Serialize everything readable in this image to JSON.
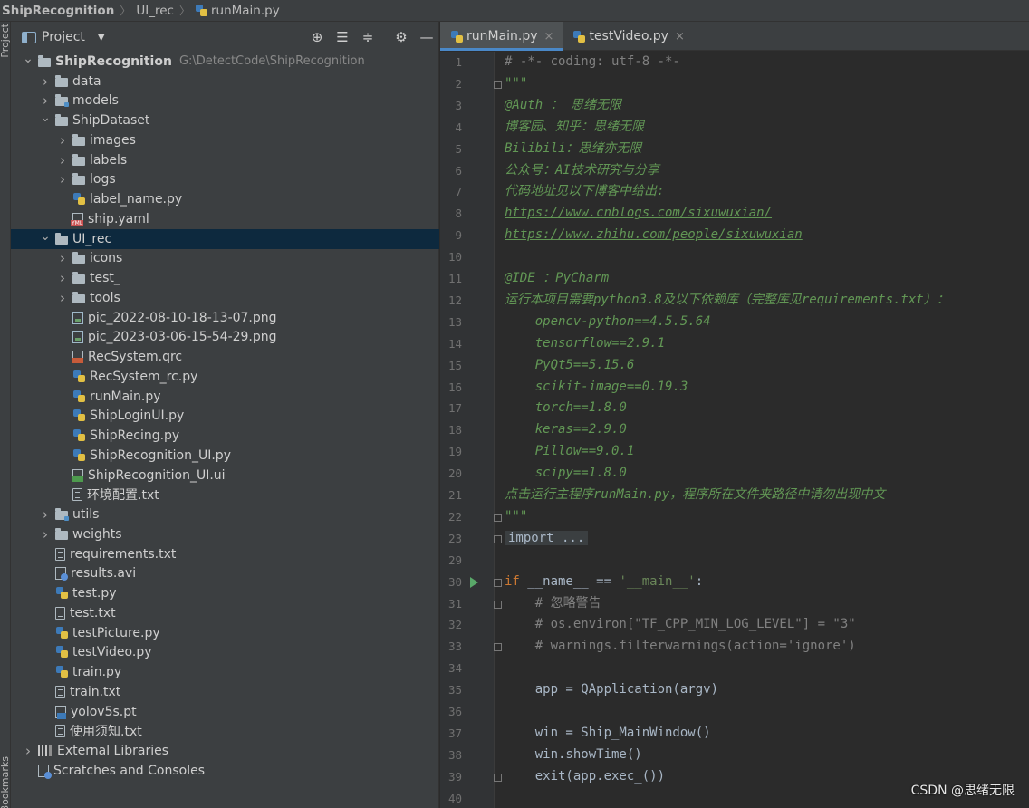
{
  "breadcrumb": {
    "project": "ShipRecognition",
    "folder": "UI_rec",
    "file": "runMain.py"
  },
  "left_strip": {
    "top_label": "Project",
    "bottom_label": "Bookmarks"
  },
  "project_panel": {
    "title": "Project",
    "tools": [
      "target-icon",
      "expand-all-icon",
      "collapse-all-icon",
      "gear-icon",
      "minimize-icon"
    ]
  },
  "tree": [
    {
      "name": "ShipRecognition",
      "path": "G:\\DetectCode\\ShipRecognition",
      "depth": 0,
      "arrow": "open",
      "icon": "folder",
      "bold": true
    },
    {
      "name": "data",
      "depth": 1,
      "arrow": "closed",
      "icon": "folder"
    },
    {
      "name": "models",
      "depth": 1,
      "arrow": "closed",
      "icon": "folder-mod"
    },
    {
      "name": "ShipDataset",
      "depth": 1,
      "arrow": "open",
      "icon": "folder"
    },
    {
      "name": "images",
      "depth": 2,
      "arrow": "closed",
      "icon": "folder"
    },
    {
      "name": "labels",
      "depth": 2,
      "arrow": "closed",
      "icon": "folder"
    },
    {
      "name": "logs",
      "depth": 2,
      "arrow": "closed",
      "icon": "folder"
    },
    {
      "name": "label_name.py",
      "depth": 2,
      "arrow": "none",
      "icon": "pyfile"
    },
    {
      "name": "ship.yaml",
      "depth": 2,
      "arrow": "none",
      "icon": "yamlfile"
    },
    {
      "name": "UI_rec",
      "depth": 1,
      "arrow": "open",
      "icon": "folder",
      "selected": true
    },
    {
      "name": "icons",
      "depth": 2,
      "arrow": "closed",
      "icon": "folder"
    },
    {
      "name": "test_",
      "depth": 2,
      "arrow": "closed",
      "icon": "folder"
    },
    {
      "name": "tools",
      "depth": 2,
      "arrow": "closed",
      "icon": "folder"
    },
    {
      "name": "pic_2022-08-10-18-13-07.png",
      "depth": 2,
      "arrow": "none",
      "icon": "imgfile"
    },
    {
      "name": "pic_2023-03-06-15-54-29.png",
      "depth": 2,
      "arrow": "none",
      "icon": "imgfile"
    },
    {
      "name": "RecSystem.qrc",
      "depth": 2,
      "arrow": "none",
      "icon": "qrcfile"
    },
    {
      "name": "RecSystem_rc.py",
      "depth": 2,
      "arrow": "none",
      "icon": "pyfile"
    },
    {
      "name": "runMain.py",
      "depth": 2,
      "arrow": "none",
      "icon": "pyfile"
    },
    {
      "name": "ShipLoginUI.py",
      "depth": 2,
      "arrow": "none",
      "icon": "pyfile"
    },
    {
      "name": "ShipRecing.py",
      "depth": 2,
      "arrow": "none",
      "icon": "pyfile"
    },
    {
      "name": "ShipRecognition_UI.py",
      "depth": 2,
      "arrow": "none",
      "icon": "pyfile"
    },
    {
      "name": "ShipRecognition_UI.ui",
      "depth": 2,
      "arrow": "none",
      "icon": "uifile"
    },
    {
      "name": "环境配置.txt",
      "depth": 2,
      "arrow": "none",
      "icon": "txtfile"
    },
    {
      "name": "utils",
      "depth": 1,
      "arrow": "closed",
      "icon": "folder-mod"
    },
    {
      "name": "weights",
      "depth": 1,
      "arrow": "closed",
      "icon": "folder"
    },
    {
      "name": "requirements.txt",
      "depth": 1,
      "arrow": "none",
      "icon": "txtfile"
    },
    {
      "name": "results.avi",
      "depth": 1,
      "arrow": "none",
      "icon": "avifile"
    },
    {
      "name": "test.py",
      "depth": 1,
      "arrow": "none",
      "icon": "pyfile"
    },
    {
      "name": "test.txt",
      "depth": 1,
      "arrow": "none",
      "icon": "txtfile"
    },
    {
      "name": "testPicture.py",
      "depth": 1,
      "arrow": "none",
      "icon": "pyfile"
    },
    {
      "name": "testVideo.py",
      "depth": 1,
      "arrow": "none",
      "icon": "pyfile"
    },
    {
      "name": "train.py",
      "depth": 1,
      "arrow": "none",
      "icon": "pyfile"
    },
    {
      "name": "train.txt",
      "depth": 1,
      "arrow": "none",
      "icon": "txtfile"
    },
    {
      "name": "yolov5s.pt",
      "depth": 1,
      "arrow": "none",
      "icon": "ptfile"
    },
    {
      "name": "使用须知.txt",
      "depth": 1,
      "arrow": "none",
      "icon": "txtfile"
    },
    {
      "name": "External Libraries",
      "depth": 0,
      "arrow": "closed",
      "icon": "libicon"
    },
    {
      "name": "Scratches and Consoles",
      "depth": 0,
      "arrow": "none",
      "icon": "scratchicon"
    }
  ],
  "editor_tabs": [
    {
      "label": "runMain.py",
      "active": true
    },
    {
      "label": "testVideo.py",
      "active": false
    }
  ],
  "code_lines": [
    {
      "n": "1",
      "style": "comment",
      "text": "# -*- coding: utf-8 -*-"
    },
    {
      "n": "2",
      "style": "doc",
      "text": "\"\"\"",
      "fold": true
    },
    {
      "n": "3",
      "style": "doc",
      "text": "@Auth ： 思绪无限"
    },
    {
      "n": "4",
      "style": "doc",
      "text": "博客园、知乎：思绪无限"
    },
    {
      "n": "5",
      "style": "doc",
      "text": "Bilibili：思绪亦无限"
    },
    {
      "n": "6",
      "style": "doc",
      "text": "公众号：AI技术研究与分享"
    },
    {
      "n": "7",
      "style": "doc",
      "text": "代码地址见以下博客中给出:"
    },
    {
      "n": "8",
      "style": "doc-link",
      "text": "https://www.cnblogs.com/sixuwuxian/"
    },
    {
      "n": "9",
      "style": "doc-link",
      "text": "https://www.zhihu.com/people/sixuwuxian"
    },
    {
      "n": "10",
      "style": "doc",
      "text": ""
    },
    {
      "n": "11",
      "style": "doc",
      "text": "@IDE ：PyCharm"
    },
    {
      "n": "12",
      "style": "doc",
      "text": "运行本项目需要python3.8及以下依赖库（完整库见requirements.txt）："
    },
    {
      "n": "13",
      "style": "doc",
      "text": "    opencv-python==4.5.5.64"
    },
    {
      "n": "14",
      "style": "doc",
      "text": "    tensorflow==2.9.1"
    },
    {
      "n": "15",
      "style": "doc",
      "text": "    PyQt5==5.15.6"
    },
    {
      "n": "16",
      "style": "doc",
      "text": "    scikit-image==0.19.3"
    },
    {
      "n": "17",
      "style": "doc",
      "text": "    torch==1.8.0"
    },
    {
      "n": "18",
      "style": "doc",
      "text": "    keras==2.9.0"
    },
    {
      "n": "19",
      "style": "doc",
      "text": "    Pillow==9.0.1"
    },
    {
      "n": "20",
      "style": "doc",
      "text": "    scipy==1.8.0"
    },
    {
      "n": "21",
      "style": "doc",
      "text": "点击运行主程序runMain.py，程序所在文件夹路径中请勿出现中文"
    },
    {
      "n": "22",
      "style": "doc",
      "text": "\"\"\"",
      "fold": true
    },
    {
      "n": "23",
      "style": "folded",
      "text": "import ...",
      "fold": true
    },
    {
      "n": "29",
      "style": "default",
      "text": ""
    },
    {
      "n": "30",
      "style": "main",
      "text": "",
      "fold": true,
      "run": true
    },
    {
      "n": "31",
      "style": "comment",
      "text": "    # 忽略警告",
      "fold": true
    },
    {
      "n": "32",
      "style": "comment",
      "text": "    # os.environ[\"TF_CPP_MIN_LOG_LEVEL\"] = \"3\""
    },
    {
      "n": "33",
      "style": "comment",
      "text": "    # warnings.filterwarnings(action='ignore')",
      "fold": true
    },
    {
      "n": "34",
      "style": "default",
      "text": ""
    },
    {
      "n": "35",
      "style": "default",
      "text": "    app = QApplication(argv)"
    },
    {
      "n": "36",
      "style": "default",
      "text": ""
    },
    {
      "n": "37",
      "style": "default",
      "text": "    win = Ship_MainWindow()"
    },
    {
      "n": "38",
      "style": "default",
      "text": "    win.showTime()"
    },
    {
      "n": "39",
      "style": "default",
      "text": "    exit(app.exec_())",
      "fold": true
    },
    {
      "n": "40",
      "style": "default",
      "text": ""
    }
  ],
  "main_line": {
    "keyword": "if",
    "name": " __name__ == ",
    "string": "'__main__'",
    "colon": ":"
  },
  "watermark": "CSDN @思绪无限"
}
